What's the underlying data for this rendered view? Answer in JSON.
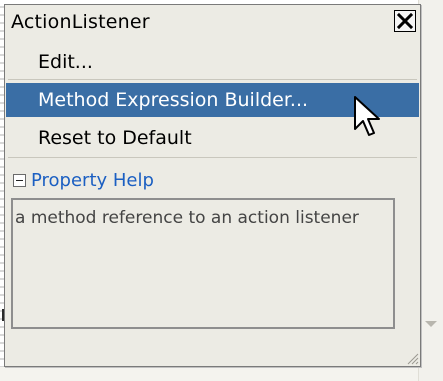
{
  "popup": {
    "title": "ActionListener",
    "menu": {
      "edit_label": "Edit...",
      "method_expression_builder_label": "Method Expression Builder...",
      "reset_to_default_label": "Reset to Default"
    },
    "help": {
      "title": "Property Help",
      "text": "a method reference to an action listener"
    }
  },
  "icons": {
    "close": "close-icon",
    "collapse": "collapse-minus-icon",
    "resize": "resize-grip-icon",
    "cursor": "mouse-pointer-icon"
  },
  "colors": {
    "selection": "#3a6ea5",
    "popup_background": "#ecebe4",
    "help_link": "#1b5fc2"
  }
}
